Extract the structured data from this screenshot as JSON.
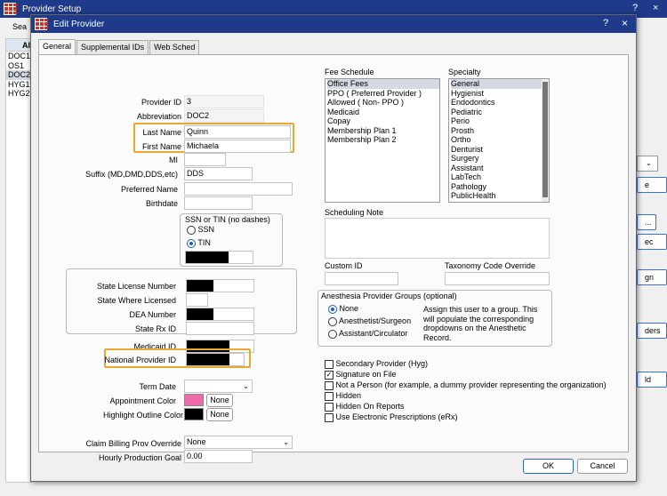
{
  "bg": {
    "title": "Provider Setup",
    "help": "?",
    "close": "×",
    "tab_label": "Sea",
    "list_header": "Al",
    "list_items": [
      "DOC1",
      "OS1",
      "DOC2",
      "HYG1",
      "HYG2"
    ],
    "right_buttons": [
      "e",
      "...",
      "ec",
      "gn",
      "ders",
      "ld"
    ]
  },
  "dialog": {
    "title": "Edit Provider",
    "help": "?",
    "close": "×",
    "tabs": [
      "General",
      "Supplemental IDs",
      "Web Sched"
    ],
    "ok": "OK",
    "cancel": "Cancel"
  },
  "form": {
    "provider_id_label": "Provider ID",
    "provider_id": "3",
    "abbreviation_label": "Abbreviation",
    "abbreviation": "DOC2",
    "last_name_label": "Last Name",
    "last_name": "Quinn",
    "first_name_label": "First Name",
    "first_name": "Michaela",
    "mi_label": "MI",
    "mi": "",
    "suffix_label": "Suffix (MD,DMD,DDS,etc)",
    "suffix": "DDS",
    "preferred_name_label": "Preferred Name",
    "preferred_name": "",
    "birthdate_label": "Birthdate",
    "birthdate": "",
    "ssn_group_label": "SSN or TIN (no dashes)",
    "ssn_option": "SSN",
    "tin_option": "TIN",
    "tin_selected": true,
    "state_license_label": "State License Number",
    "state_where_licensed_label": "State Where Licensed",
    "dea_label": "DEA Number",
    "state_rx_label": "State Rx ID",
    "medicaid_id_label": "Medicaid ID",
    "npi_label": "National Provider ID",
    "term_date_label": "Term Date",
    "appt_color_label": "Appointment Color",
    "appt_color": "#f06aa9",
    "highlight_label": "Highlight Outline Color",
    "highlight_color": "#000000",
    "none_label": "None",
    "claim_billing_label": "Claim Billing Prov Override",
    "claim_billing": "None",
    "hourly_goal_label": "Hourly Production Goal",
    "hourly_goal": "0.00"
  },
  "fee_schedule": {
    "label": "Fee Schedule",
    "items": [
      "Office Fees",
      "PPO ( Preferred Provider )",
      "Allowed ( Non- PPO )",
      "Medicaid",
      "Copay",
      "Membership Plan 1",
      "Membership Plan 2"
    ],
    "selected": 0
  },
  "specialty": {
    "label": "Specialty",
    "items": [
      "General",
      "Hygienist",
      "Endodontics",
      "Pediatric",
      "Perio",
      "Prosth",
      "Ortho",
      "Denturist",
      "Surgery",
      "Assistant",
      "LabTech",
      "Pathology",
      "PublicHealth"
    ],
    "selected": 0
  },
  "scheduling_note_label": "Scheduling Note",
  "custom_id_label": "Custom ID",
  "taxonomy_label": "Taxonomy Code Override",
  "anesthesia": {
    "label": "Anesthesia Provider Groups (optional)",
    "options": [
      "None",
      "Anesthetist/Surgeon",
      "Assistant/Circulator"
    ],
    "selected": 0,
    "note": "Assign this user to a group. This will populate the corresponding dropdowns on the Anesthetic Record."
  },
  "checkboxes": [
    {
      "label": "Secondary Provider (Hyg)",
      "checked": false
    },
    {
      "label": "Signature on File",
      "checked": true
    },
    {
      "label": "Not a Person (for example, a dummy provider representing the organization)",
      "checked": false
    },
    {
      "label": "Hidden",
      "checked": false
    },
    {
      "label": "Hidden On Reports",
      "checked": false
    },
    {
      "label": "Use Electronic Prescriptions (eRx)",
      "checked": false
    }
  ]
}
